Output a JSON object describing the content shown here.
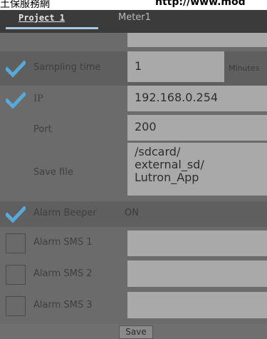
{
  "top_strip": {
    "left_text": "土保服務網",
    "right_text": "http://www.mod"
  },
  "tabs": [
    {
      "label": "Project 1"
    },
    {
      "label": "Meter1"
    }
  ],
  "rows": {
    "sampling": {
      "label": "Sampling time",
      "value": "1",
      "units": "Minutes",
      "checked": true
    },
    "ip": {
      "label": "IP",
      "value": "192.168.0.254",
      "checked": true
    },
    "port": {
      "label": "Port",
      "value": "200"
    },
    "save_file": {
      "label": "Save file",
      "line1": "/sdcard/",
      "line2": "external_sd/",
      "line3": "Lutron_App"
    },
    "alarm_beeper": {
      "label": "Alarm Beeper",
      "value": "ON",
      "checked": true
    },
    "alarm_sms_1": {
      "label": "Alarm SMS 1",
      "value": "",
      "checked": false
    },
    "alarm_sms_2": {
      "label": "Alarm SMS 2",
      "value": "",
      "checked": false
    },
    "alarm_sms_3": {
      "label": "Alarm SMS 3",
      "value": "",
      "checked": false
    }
  },
  "save_button": {
    "label": "Save"
  },
  "colors": {
    "check": "#58a9d8",
    "field": "#a9a9a9",
    "tab_underline": "#a9c9dc"
  }
}
